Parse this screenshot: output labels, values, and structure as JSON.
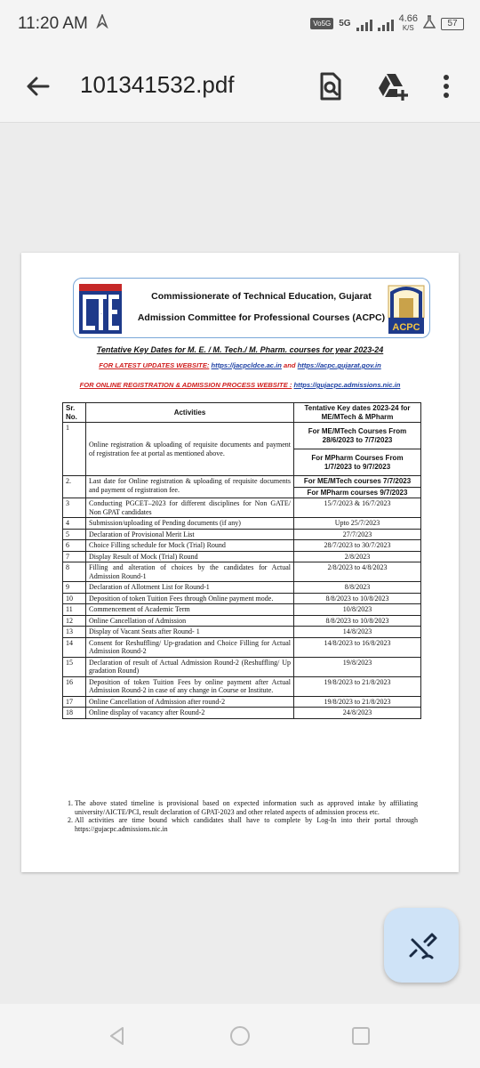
{
  "status_bar": {
    "time": "11:20 AM",
    "network_label": "5G",
    "volte_label": "Vo5G",
    "net_speed": "4.66",
    "net_speed_unit": "K/S",
    "battery": "57"
  },
  "app_bar": {
    "title": "101341532.pdf",
    "back_icon": "arrow-back-icon",
    "search_icon": "doc-search-icon",
    "drive_icon": "drive-add-icon",
    "more_icon": "more-vert-icon"
  },
  "document": {
    "org_line1": "Commissionerate of Technical Education, Gujarat",
    "org_line2": "Admission Committee for Professional Courses (ACPC)",
    "logo_left": "CTE",
    "logo_right": "ACPC",
    "heading": "Tentative Key Dates for M. E. / M. Tech./ M. Pharm. courses for  year 2023-24",
    "updates_label": "FOR LATEST UPDATES WEBSITE:",
    "updates_link1": "https://jacpcldce.ac.in",
    "updates_and": "and",
    "updates_link2": "https://acpc.gujarat.gov.in",
    "registration_label": "FOR ONLINE REGISTRATION & ADMISSION PROCESS WEBSITE :",
    "registration_link": "https://gujacpc.admissions.nic.in",
    "table": {
      "headers": [
        "Sr. No.",
        "Activities",
        "Tentative Key dates 2023-24 for ME/MTech & MPharm"
      ],
      "row1": {
        "sr": "1",
        "activity": "Online registration & uploading of requisite documents and payment of registration fee at portal as mentioned above.",
        "date_a": "For ME/MTech Courses From 28/6/2023 to 7/7/2023",
        "date_b": "For MPharm Courses From 1/7/2023 to 9/7/2023"
      },
      "row2": {
        "sr": "2.",
        "activity": "Last date for Online registration & uploading of requisite documents and payment of registration fee.",
        "date_a": "For ME/MTech courses 7/7/2023",
        "date_b": "For MPharm courses 9/7/2023"
      },
      "rows": [
        {
          "sr": "3",
          "activity": "Conducting PGCET–2023 for different disciplines for Non GATE/ Non GPAT candidates",
          "date": "15/7/2023 & 16/7/2023"
        },
        {
          "sr": "4",
          "activity": "Submission/uploading of Pending documents (if any)",
          "date": "Upto 25/7/2023"
        },
        {
          "sr": "5",
          "activity": "Declaration of Provisional Merit List",
          "date": "27/7/2023"
        },
        {
          "sr": "6",
          "activity": "Choice Filling schedule for Mock (Trial) Round",
          "date": "28/7/2023 to 30/7/2023"
        },
        {
          "sr": "7",
          "activity": "Display Result of Mock (Trial) Round",
          "date": "2/8/2023"
        },
        {
          "sr": "8",
          "activity": "Filling and alteration of choices by the candidates for Actual Admission Round-1",
          "date": "2/8/2023 to 4/8/2023"
        },
        {
          "sr": "9",
          "activity": "Declaration of  Allotment List for Round-1",
          "date": "8/8/2023"
        },
        {
          "sr": "10",
          "activity": "Deposition of token Tuition Fees through Online payment mode.",
          "date": "8/8/2023 to 10/8/2023"
        },
        {
          "sr": "11",
          "activity": "Commencement of Academic Term",
          "date": "10/8/2023"
        },
        {
          "sr": "12",
          "activity": "Online Cancellation of Admission",
          "date": "8/8/2023 to 10/8/2023"
        },
        {
          "sr": "13",
          "activity": "Display of Vacant Seats after Round- 1",
          "date": "14/8/2023"
        },
        {
          "sr": "14",
          "activity": "Consent for Reshuffling/ Up-gradation and Choice Filling for Actual Admission Round-2",
          "date": "14/8/2023 to 16/8/2023"
        },
        {
          "sr": "15",
          "activity": "Declaration of result of Actual Admission Round-2 (Reshuffling/ Up gradation Round)",
          "date": "19/8/2023"
        },
        {
          "sr": "16",
          "activity": "Deposition of token Tuition Fees by online payment after Actual Admission Round-2 in case of any change in Course or Institute.",
          "date": "19/8/2023 to 21/8/2023"
        },
        {
          "sr": "17",
          "activity": "Online Cancellation of Admission after round-2",
          "date": "19/8/2023 to 21/8/2023"
        },
        {
          "sr": "18",
          "activity": "Online display of vacancy after Round-2",
          "date": "24/8/2023"
        }
      ]
    },
    "notes": [
      "The above stated timeline is provisional based on expected information such as approved intake by affiliating university/AICTE/PCI, result declaration of GPAT-2023 and other related aspects of admission process etc.",
      "All activities are time bound which candidates shall have to complete by Log-In into their portal through https://gujacpc.admissions.nic.in"
    ]
  },
  "fab": {
    "icon": "edit-pen-icon"
  },
  "nav_bar": {
    "back_icon": "nav-back-icon",
    "home_icon": "nav-home-icon",
    "recents_icon": "nav-recents-icon"
  }
}
